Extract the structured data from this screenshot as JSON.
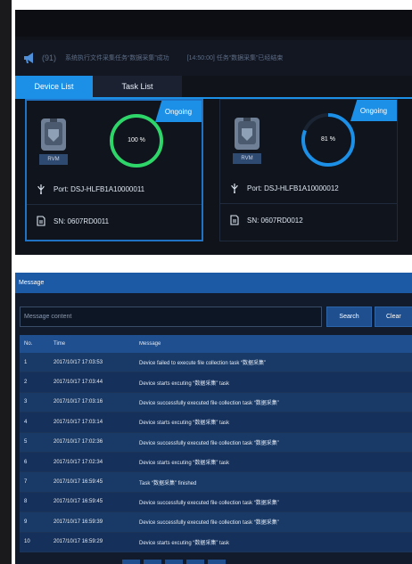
{
  "notice": {
    "count": "(91)",
    "message": "系统执行文件采集任务“数据采集”成功",
    "message2": "[14:50:00] 任务“数据采集”已经结束"
  },
  "tabs": [
    {
      "label": "Device List",
      "active": true
    },
    {
      "label": "Task List",
      "active": false
    }
  ],
  "devices": [
    {
      "status": "Ongoing",
      "type": "RVM",
      "progress_label": "100 %",
      "progress": 1.0,
      "ring_color": "#2ed66a",
      "port": "Port: DSJ-HLFB1A10000011",
      "sn": "SN: 0607RD0011"
    },
    {
      "status": "Ongoing",
      "type": "RVM",
      "progress_label": "81 %",
      "progress": 0.81,
      "ring_color": "#1c8fe6",
      "port": "Port: DSJ-HLFB1A10000012",
      "sn": "SN: 0607RD0012"
    }
  ],
  "message_panel": {
    "title": "Message",
    "placeholder": "Message content",
    "search_label": "Search",
    "clear_label": "Clear",
    "columns": {
      "no": "No.",
      "time": "Time",
      "message": "Message"
    },
    "rows": [
      {
        "no": "1",
        "time": "2017/10/17 17:03:53",
        "message": "Device  failed to execute file collection task “数据采集”"
      },
      {
        "no": "2",
        "time": "2017/10/17 17:03:44",
        "message": "Device  starts excuting “数据采集” task"
      },
      {
        "no": "3",
        "time": "2017/10/17 17:03:16",
        "message": "Device  successfully executed file collection task “数据采集”"
      },
      {
        "no": "4",
        "time": "2017/10/17 17:03:14",
        "message": "Device  starts excuting “数据采集” task"
      },
      {
        "no": "5",
        "time": "2017/10/17 17:02:36",
        "message": "Device  successfully executed file collection task “数据采集”"
      },
      {
        "no": "6",
        "time": "2017/10/17 17:02:34",
        "message": "Device  starts excuting “数据采集” task"
      },
      {
        "no": "7",
        "time": "2017/10/17 16:59:45",
        "message": "Task “数据采集” finished"
      },
      {
        "no": "8",
        "time": "2017/10/17 16:59:45",
        "message": "Device  successfully executed file collection task “数据采集”"
      },
      {
        "no": "9",
        "time": "2017/10/17 16:59:39",
        "message": "Device  successfully executed file collection task “数据采集”"
      },
      {
        "no": "10",
        "time": "2017/10/17 16:59:29",
        "message": "Device  starts excuting “数据采集” task"
      }
    ]
  },
  "colors": {
    "accent": "#1c8fe6",
    "panel_bg": "#10131a",
    "table_header": "#1f4f8f"
  }
}
